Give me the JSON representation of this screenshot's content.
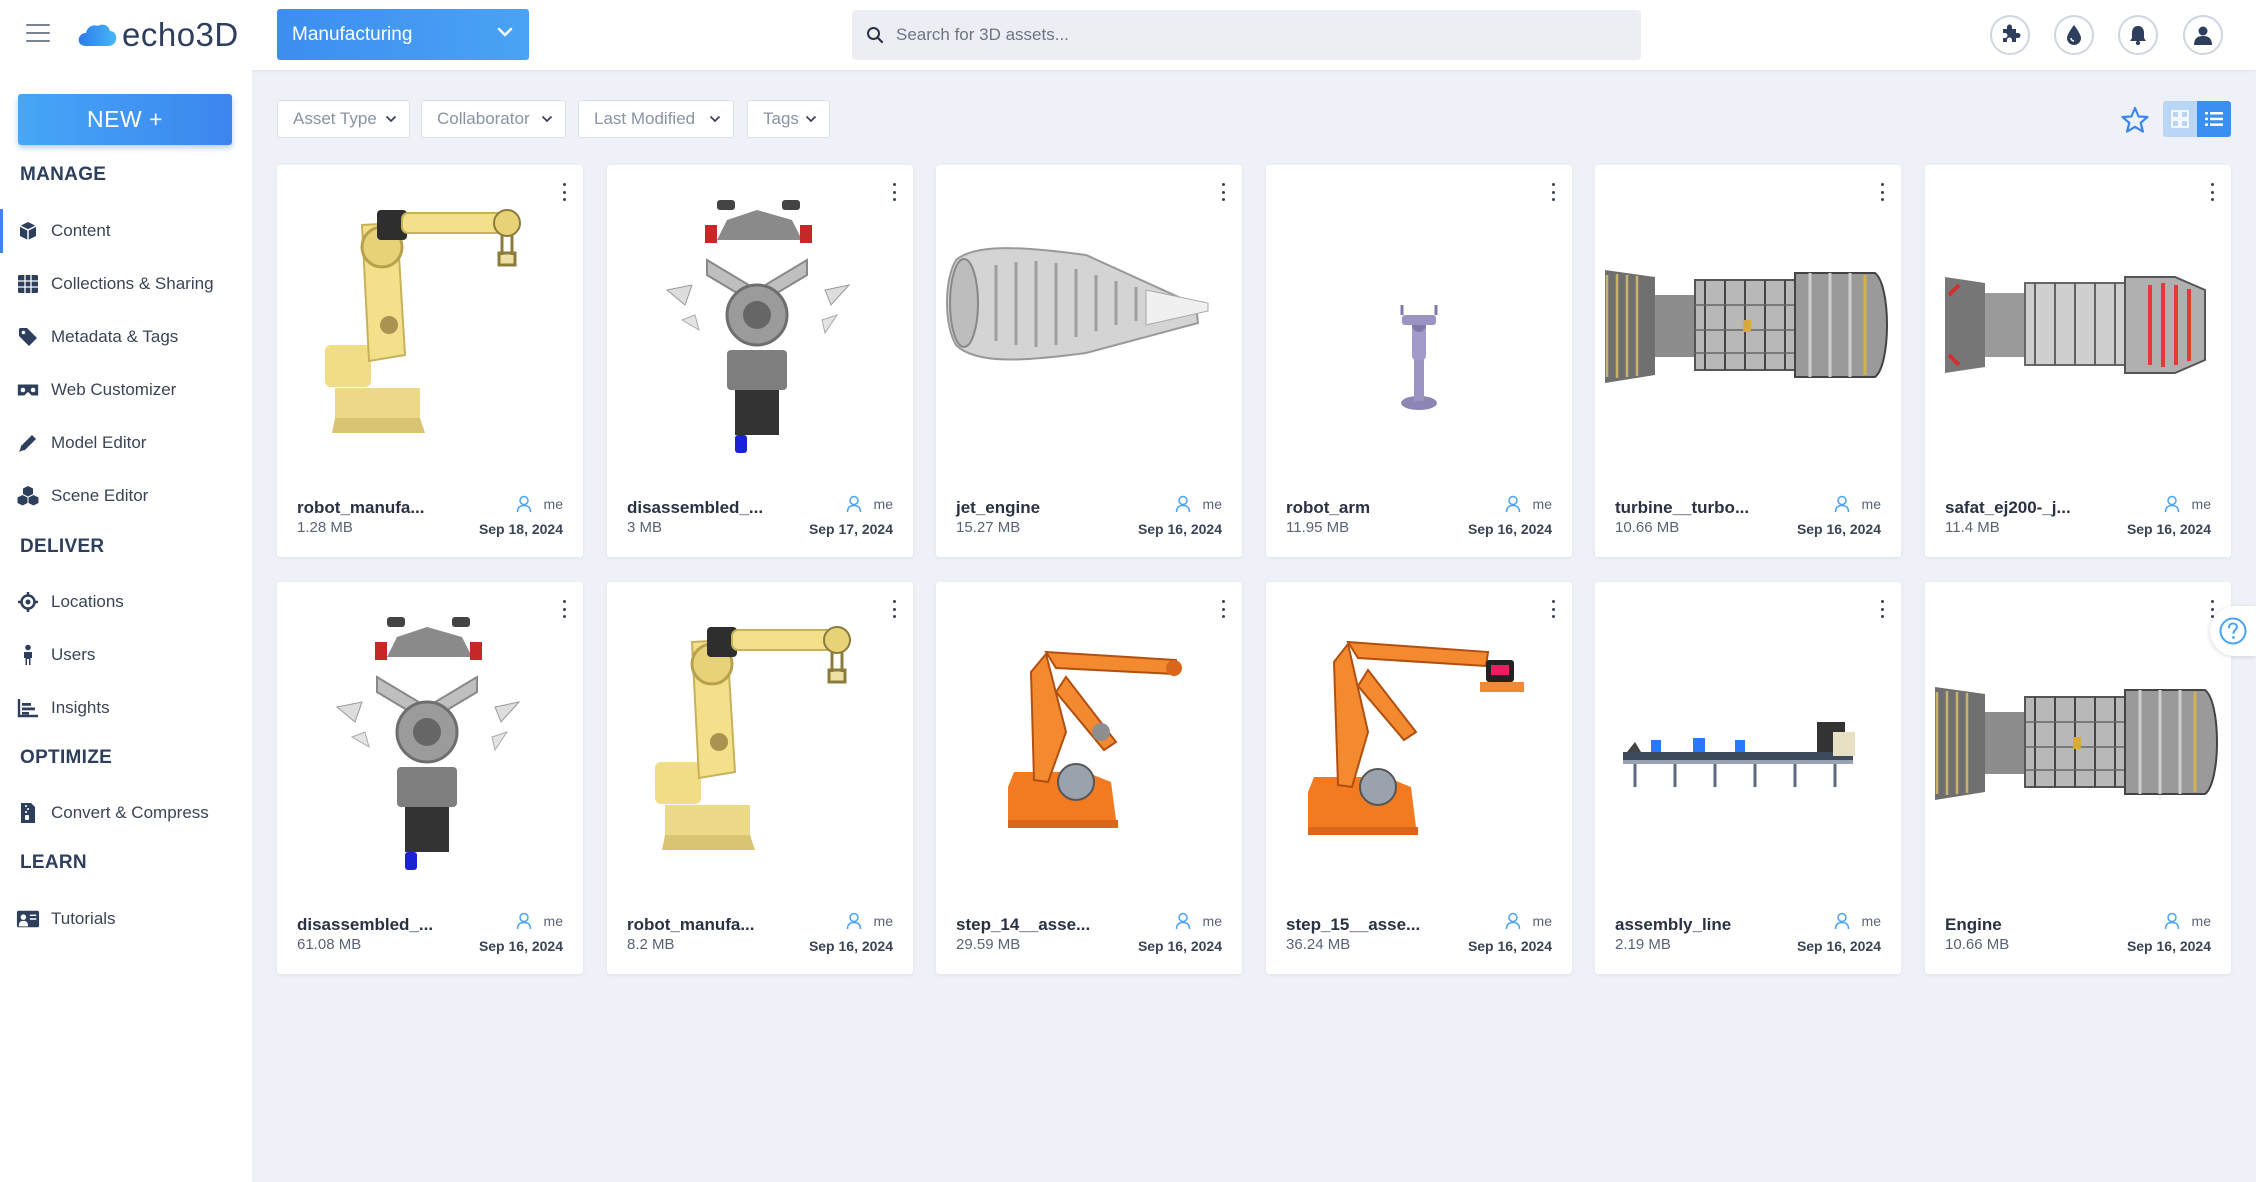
{
  "header": {
    "logo_text": "echo3D",
    "project": "Manufacturing",
    "search_placeholder": "Search for 3D assets..."
  },
  "sidebar": {
    "new_label": "NEW +",
    "sections": {
      "manage": "MANAGE",
      "deliver": "DELIVER",
      "optimize": "OPTIMIZE",
      "learn": "LEARN"
    },
    "items": {
      "content": "Content",
      "collections": "Collections & Sharing",
      "metadata": "Metadata & Tags",
      "web_customizer": "Web Customizer",
      "model_editor": "Model Editor",
      "scene_editor": "Scene Editor",
      "locations": "Locations",
      "users": "Users",
      "insights": "Insights",
      "convert": "Convert & Compress",
      "tutorials": "Tutorials"
    }
  },
  "filters": {
    "asset_type": "Asset Type",
    "collaborator": "Collaborator",
    "last_modified": "Last Modified",
    "tags": "Tags"
  },
  "assets": [
    {
      "name": "robot_manufa...",
      "size": "1.28 MB",
      "owner": "me",
      "date": "Sep 18, 2024",
      "thumb": "robot-arm-cream"
    },
    {
      "name": "disassembled_...",
      "size": "3 MB",
      "owner": "me",
      "date": "Sep 17, 2024",
      "thumb": "engine-exploded"
    },
    {
      "name": "jet_engine",
      "size": "15.27 MB",
      "owner": "me",
      "date": "Sep 16, 2024",
      "thumb": "jet-engine"
    },
    {
      "name": "robot_arm",
      "size": "11.95 MB",
      "owner": "me",
      "date": "Sep 16, 2024",
      "thumb": "small-robot-arm"
    },
    {
      "name": "turbine__turbo...",
      "size": "10.66 MB",
      "owner": "me",
      "date": "Sep 16, 2024",
      "thumb": "turbine"
    },
    {
      "name": "safat_ej200-_j...",
      "size": "11.4 MB",
      "owner": "me",
      "date": "Sep 16, 2024",
      "thumb": "turbine-red"
    },
    {
      "name": "disassembled_...",
      "size": "61.08 MB",
      "owner": "me",
      "date": "Sep 16, 2024",
      "thumb": "engine-exploded"
    },
    {
      "name": "robot_manufa...",
      "size": "8.2 MB",
      "owner": "me",
      "date": "Sep 16, 2024",
      "thumb": "robot-arm-cream"
    },
    {
      "name": "step_14__asse...",
      "size": "29.59 MB",
      "owner": "me",
      "date": "Sep 16, 2024",
      "thumb": "orange-robot"
    },
    {
      "name": "step_15__asse...",
      "size": "36.24 MB",
      "owner": "me",
      "date": "Sep 16, 2024",
      "thumb": "orange-robot-gripper"
    },
    {
      "name": "assembly_line",
      "size": "2.19 MB",
      "owner": "me",
      "date": "Sep 16, 2024",
      "thumb": "assembly-line"
    },
    {
      "name": "Engine",
      "size": "10.66 MB",
      "owner": "me",
      "date": "Sep 16, 2024",
      "thumb": "turbine"
    }
  ],
  "colors": {
    "accent": "#3b86ee",
    "brand_dark": "#2d3f5c",
    "background": "#eef1f7"
  }
}
